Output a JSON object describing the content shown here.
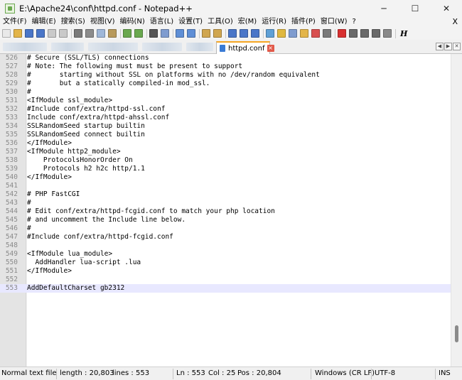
{
  "window": {
    "title": "E:\\Apache24\\conf\\httpd.conf - Notepad++",
    "minimize_glyph": "─",
    "maximize_glyph": "☐",
    "close_glyph": "✕"
  },
  "menu": {
    "items": [
      "文件(F)",
      "编辑(E)",
      "搜索(S)",
      "视图(V)",
      "编码(N)",
      "语言(L)",
      "设置(T)",
      "工具(O)",
      "宏(M)",
      "运行(R)",
      "插件(P)",
      "窗口(W)",
      "?"
    ],
    "close_glyph": "X"
  },
  "toolbar": {
    "icons": [
      {
        "name": "new-file-icon",
        "color": "#e9e9e9"
      },
      {
        "name": "open-file-icon",
        "color": "#e3b54a"
      },
      {
        "name": "save-icon",
        "color": "#4a76c8"
      },
      {
        "name": "save-all-icon",
        "color": "#4a76c8"
      },
      {
        "name": "close-file-icon",
        "color": "#c9c9c9"
      },
      {
        "name": "close-all-icon",
        "color": "#c9c9c9"
      },
      {
        "name": "print-icon",
        "color": "#7a7a7a"
      },
      {
        "name": "cut-icon",
        "color": "#8c8c8c"
      },
      {
        "name": "copy-icon",
        "color": "#9fb7d8"
      },
      {
        "name": "paste-icon",
        "color": "#b89a5c"
      },
      {
        "name": "undo-icon",
        "color": "#6aa84f"
      },
      {
        "name": "redo-icon",
        "color": "#6aa84f"
      },
      {
        "name": "find-icon",
        "color": "#555555"
      },
      {
        "name": "replace-icon",
        "color": "#7f9ccf"
      },
      {
        "name": "zoom-in-icon",
        "color": "#5f8fd6"
      },
      {
        "name": "zoom-out-icon",
        "color": "#5f8fd6"
      },
      {
        "name": "sync-vertical-icon",
        "color": "#d0a650"
      },
      {
        "name": "sync-horizontal-icon",
        "color": "#d0a650"
      },
      {
        "name": "word-wrap-icon",
        "color": "#4a76c8"
      },
      {
        "name": "show-all-chars-icon",
        "color": "#4a76c8"
      },
      {
        "name": "indent-guide-icon",
        "color": "#4a76c8"
      },
      {
        "name": "language-icon",
        "color": "#5fa0d6"
      },
      {
        "name": "doc-map-icon",
        "color": "#e0b840"
      },
      {
        "name": "function-list-icon",
        "color": "#7f9ccf"
      },
      {
        "name": "folder-as-workspace-icon",
        "color": "#e3b54a"
      },
      {
        "name": "monitoring-icon",
        "color": "#d85050"
      },
      {
        "name": "view-icon",
        "color": "#7a7a7a"
      },
      {
        "name": "record-macro-icon",
        "color": "#d83030"
      },
      {
        "name": "stop-macro-icon",
        "color": "#6a6a6a"
      },
      {
        "name": "play-macro-icon",
        "color": "#6a6a6a"
      },
      {
        "name": "run-macro-multiple-icon",
        "color": "#6a6a6a"
      },
      {
        "name": "save-macro-icon",
        "color": "#8a8a8a"
      }
    ],
    "h_glyph": "H"
  },
  "tabs": {
    "active_label": "httpd.conf",
    "close_glyph": "×",
    "prev_glyph": "◀",
    "next_glyph": "▶",
    "menu_glyph": "✕"
  },
  "editor": {
    "lines": [
      {
        "n": "526",
        "t": "# Secure (SSL/TLS) connections"
      },
      {
        "n": "527",
        "t": "# Note: The following must must be present to support"
      },
      {
        "n": "528",
        "t": "#       starting without SSL on platforms with no /dev/random equivalent"
      },
      {
        "n": "529",
        "t": "#       but a statically compiled-in mod_ssl."
      },
      {
        "n": "530",
        "t": "#"
      },
      {
        "n": "531",
        "t": "<IfModule ssl_module>"
      },
      {
        "n": "532",
        "t": "#Include conf/extra/httpd-ssl.conf"
      },
      {
        "n": "533",
        "t": "Include conf/extra/httpd-ahssl.conf"
      },
      {
        "n": "534",
        "t": "SSLRandomSeed startup builtin"
      },
      {
        "n": "535",
        "t": "SSLRandomSeed connect builtin"
      },
      {
        "n": "536",
        "t": "</IfModule>"
      },
      {
        "n": "537",
        "t": "<IfModule http2_module>"
      },
      {
        "n": "538",
        "t": "    ProtocolsHonorOrder On"
      },
      {
        "n": "539",
        "t": "    Protocols h2 h2c http/1.1"
      },
      {
        "n": "540",
        "t": "</IfModule>"
      },
      {
        "n": "541",
        "t": ""
      },
      {
        "n": "542",
        "t": "# PHP FastCGI"
      },
      {
        "n": "543",
        "t": "#"
      },
      {
        "n": "544",
        "t": "# Edit conf/extra/httpd-fcgid.conf to match your php location"
      },
      {
        "n": "545",
        "t": "# and uncomment the Include line below."
      },
      {
        "n": "546",
        "t": "#"
      },
      {
        "n": "547",
        "t": "#Include conf/extra/httpd-fcgid.conf"
      },
      {
        "n": "548",
        "t": ""
      },
      {
        "n": "549",
        "t": "<IfModule lua_module>"
      },
      {
        "n": "550",
        "t": "  AddHandler lua-script .lua"
      },
      {
        "n": "551",
        "t": "</IfModule>"
      },
      {
        "n": "552",
        "t": ""
      },
      {
        "n": "553",
        "t": "AddDefaultCharset gb2312",
        "current": true
      }
    ]
  },
  "status": {
    "file_type": "Normal text file",
    "length": "length : 20,803",
    "lines": "lines : 553",
    "ln": "Ln : 553",
    "col": "Col : 25",
    "pos": "Pos : 20,804",
    "eol": "Windows (CR LF)",
    "encoding": "UTF-8",
    "mode": "INS"
  }
}
